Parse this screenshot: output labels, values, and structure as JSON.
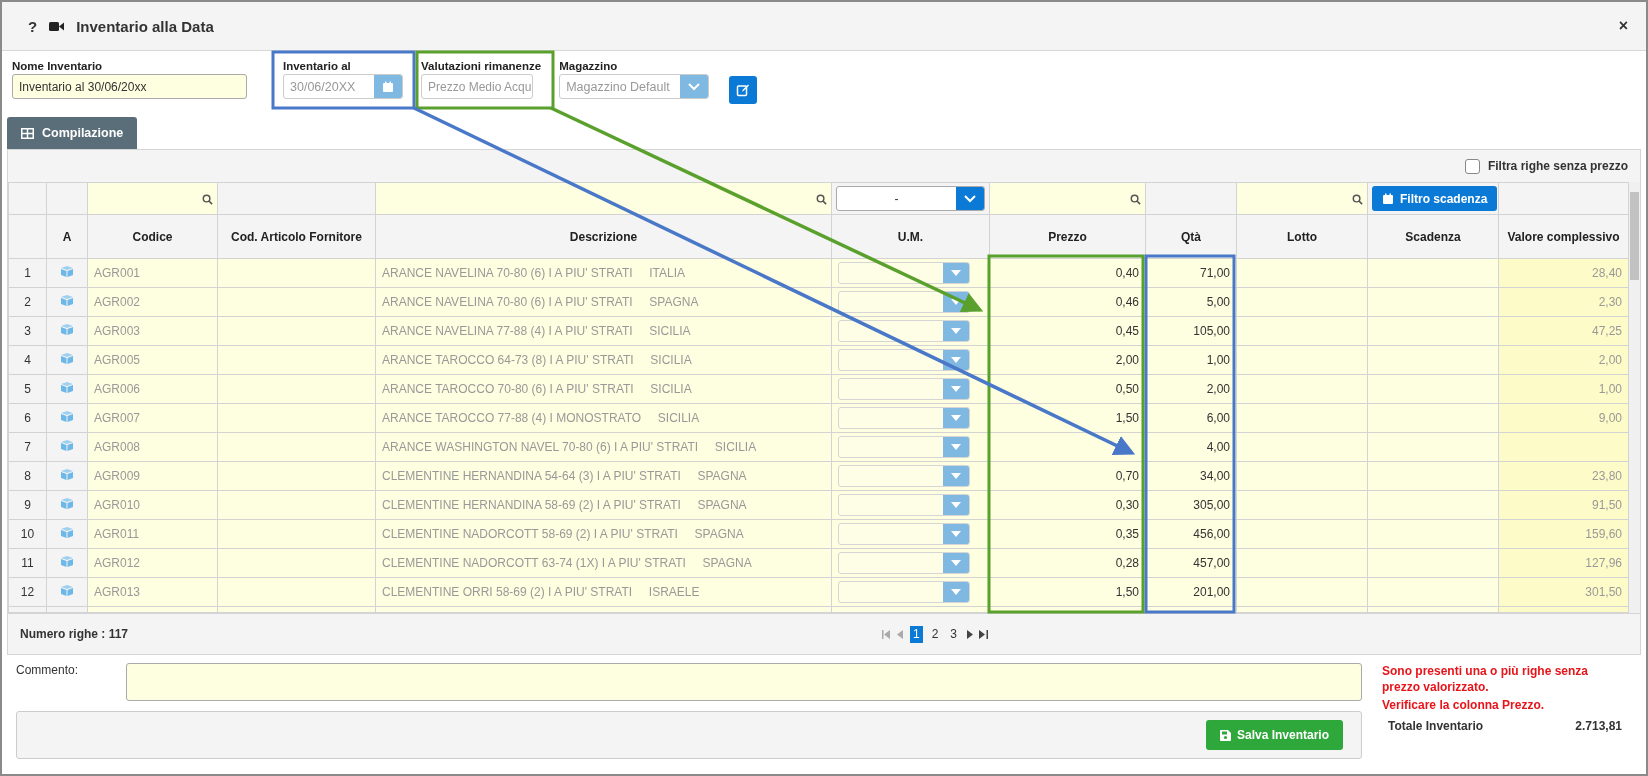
{
  "window": {
    "help": "?",
    "title": "Inventario alla Data",
    "close": "×"
  },
  "form": {
    "fields": [
      {
        "kind": "text",
        "label": "Nome Inventario",
        "value": "Inventario al 30/06/20xx",
        "disabled": false
      },
      {
        "kind": "date",
        "label": "Inventario al",
        "value": "30/06/20XX",
        "disabled": true
      },
      {
        "kind": "text",
        "label": "Valutazioni rimanenze",
        "value": "Prezzo Medio Acqu",
        "disabled": true
      },
      {
        "kind": "select",
        "label": "Magazzino",
        "value": "Magazzino Default",
        "disabled": true
      }
    ]
  },
  "tabs": [
    {
      "label": "Compilazione",
      "selected": true
    }
  ],
  "filter_checkbox": {
    "label": "Filtra righe senza prezzo",
    "checked": false
  },
  "table": {
    "um_filter": "-",
    "expiry_filter_button": "Filtro scadenza",
    "columns": [
      "A",
      "Codice",
      "Cod. Articolo Fornitore",
      "Descrizione",
      "U.M.",
      "Prezzo",
      "Qtà",
      "Lotto",
      "Scadenza",
      "Valore complessivo"
    ],
    "rows": [
      {
        "n": "1",
        "codice": "AGR001",
        "descrizione": "ARANCE NAVELINA 70-80 (6) I A PIU' STRATI     ITALIA",
        "prezzo": "0,40",
        "qta": "71,00",
        "valore": "28,40"
      },
      {
        "n": "2",
        "codice": "AGR002",
        "descrizione": "ARANCE NAVELINA 70-80 (6) I A PIU' STRATI     SPAGNA",
        "prezzo": "0,46",
        "qta": "5,00",
        "valore": "2,30"
      },
      {
        "n": "3",
        "codice": "AGR003",
        "descrizione": "ARANCE NAVELINA 77-88 (4) I A PIU' STRATI     SICILIA",
        "prezzo": "0,45",
        "qta": "105,00",
        "valore": "47,25"
      },
      {
        "n": "4",
        "codice": "AGR005",
        "descrizione": "ARANCE TAROCCO 64-73 (8) I A PIU' STRATI     SICILIA",
        "prezzo": "2,00",
        "qta": "1,00",
        "valore": "2,00"
      },
      {
        "n": "5",
        "codice": "AGR006",
        "descrizione": "ARANCE TAROCCO 70-80 (6) I A PIU' STRATI     SICILIA",
        "prezzo": "0,50",
        "qta": "2,00",
        "valore": "1,00"
      },
      {
        "n": "6",
        "codice": "AGR007",
        "descrizione": "ARANCE TAROCCO 77-88 (4) I MONOSTRATO     SICILIA",
        "prezzo": "1,50",
        "qta": "6,00",
        "valore": "9,00"
      },
      {
        "n": "7",
        "codice": "AGR008",
        "descrizione": "ARANCE WASHINGTON NAVEL 70-80 (6) I A PIU' STRATI     SICILIA",
        "qta": "4,00"
      },
      {
        "n": "8",
        "codice": "AGR009",
        "descrizione": "CLEMENTINE HERNANDINA 54-64 (3) I A PIU' STRATI     SPAGNA",
        "prezzo": "0,70",
        "qta": "34,00",
        "valore": "23,80"
      },
      {
        "n": "9",
        "codice": "AGR010",
        "descrizione": "CLEMENTINE HERNANDINA 58-69 (2) I A PIU' STRATI     SPAGNA",
        "prezzo": "0,30",
        "qta": "305,00",
        "valore": "91,50"
      },
      {
        "n": "10",
        "codice": "AGR011",
        "descrizione": "CLEMENTINE NADORCOTT 58-69 (2) I A PIU' STRATI     SPAGNA",
        "prezzo": "0,35",
        "qta": "456,00",
        "valore": "159,60"
      },
      {
        "n": "11",
        "codice": "AGR012",
        "descrizione": "CLEMENTINE NADORCOTT 63-74 (1X) I A PIU' STRATI     SPAGNA",
        "prezzo": "0,28",
        "qta": "457,00",
        "valore": "127,96"
      },
      {
        "n": "12",
        "codice": "AGR013",
        "descrizione": "CLEMENTINE ORRI 58-69 (2) I A PIU' STRATI     ISRAELE",
        "prezzo": "1,50",
        "qta": "201,00",
        "valore": "301,50"
      }
    ]
  },
  "footer": {
    "row_count": "Numero righe : 117",
    "pages": [
      {
        "label": "1",
        "selected": true
      },
      {
        "label": "2",
        "selected": false
      },
      {
        "label": "3",
        "selected": false
      }
    ]
  },
  "comment": {
    "label": "Commento:"
  },
  "warning": [
    "Sono presenti una o più righe senza prezzo valorizzato.",
    "Verificare la colonna Prezzo."
  ],
  "total": {
    "label": "Totale Inventario",
    "value": "2.713,81"
  },
  "save_button": "Salva Inventario"
}
